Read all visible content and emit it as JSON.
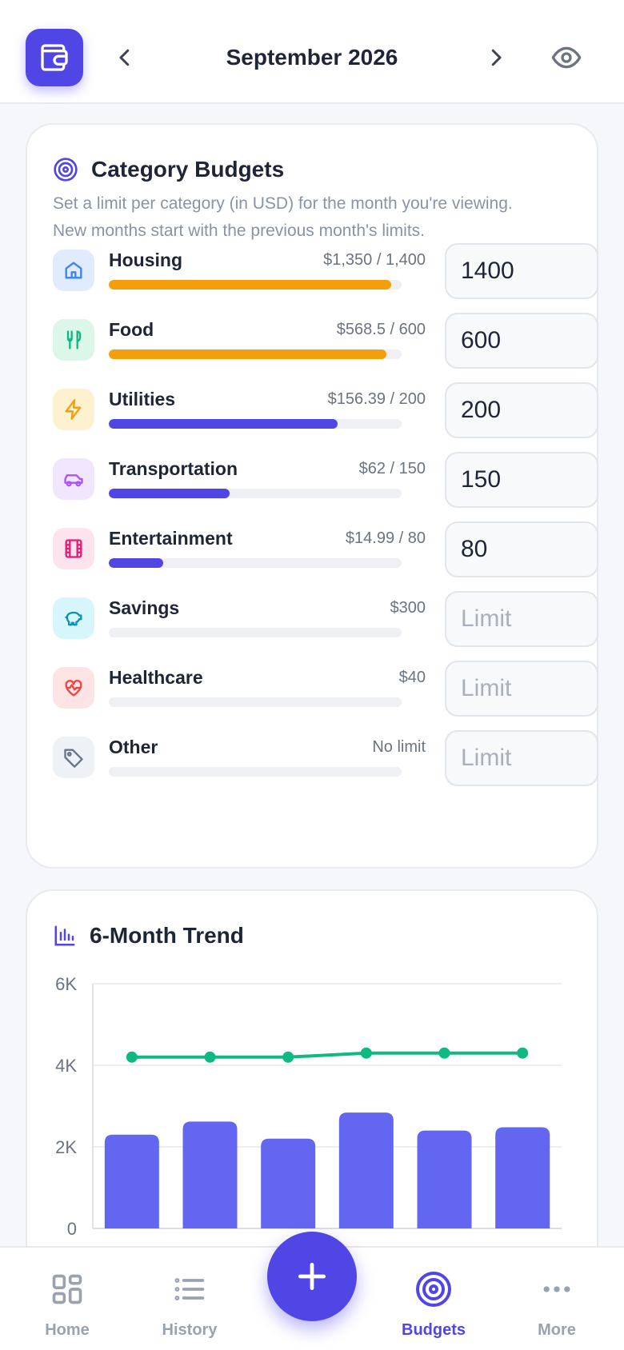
{
  "header": {
    "month_label": "September 2026"
  },
  "budgets": {
    "title": "Category Budgets",
    "description_line1": "Set a limit per category (in USD) for the month you're viewing.",
    "description_line2": "New months start with the previous month's limits.",
    "categories": [
      {
        "name": "Housing",
        "amount": "$1,350 / 1,400",
        "limit_value": "1400",
        "placeholder": "Limit",
        "progress": 0.964,
        "bar_color": "#f59e0b",
        "icon": "home-icon",
        "icon_bg": "#e0ebfd",
        "icon_color": "#3b82f6"
      },
      {
        "name": "Food",
        "amount": "$568.5 / 600",
        "limit_value": "600",
        "placeholder": "Limit",
        "progress": 0.9475,
        "bar_color": "#f59e0b",
        "icon": "fork-knife-icon",
        "icon_bg": "#dcf7ea",
        "icon_color": "#10b981"
      },
      {
        "name": "Utilities",
        "amount": "$156.39 / 200",
        "limit_value": "200",
        "placeholder": "Limit",
        "progress": 0.782,
        "bar_color": "#4f46e5",
        "icon": "bolt-icon",
        "icon_bg": "#fdf1cf",
        "icon_color": "#f59e0b"
      },
      {
        "name": "Transportation",
        "amount": "$62 / 150",
        "limit_value": "150",
        "placeholder": "Limit",
        "progress": 0.413,
        "bar_color": "#4f46e5",
        "icon": "car-icon",
        "icon_bg": "#f1e6fd",
        "icon_color": "#a855f7"
      },
      {
        "name": "Entertainment",
        "amount": "$14.99 / 80",
        "limit_value": "80",
        "placeholder": "Limit",
        "progress": 0.187,
        "bar_color": "#4f46e5",
        "icon": "film-icon",
        "icon_bg": "#fde3ee",
        "icon_color": "#e11d74"
      },
      {
        "name": "Savings",
        "amount": "$300",
        "limit_value": "",
        "placeholder": "Limit",
        "progress": 0,
        "bar_color": "#4f46e5",
        "icon": "piggy-bank-icon",
        "icon_bg": "#d6f6fb",
        "icon_color": "#0891b2"
      },
      {
        "name": "Healthcare",
        "amount": "$40",
        "limit_value": "",
        "placeholder": "Limit",
        "progress": 0,
        "bar_color": "#4f46e5",
        "icon": "heart-pulse-icon",
        "icon_bg": "#fde4e4",
        "icon_color": "#ef4444"
      },
      {
        "name": "Other",
        "amount": "No limit",
        "limit_value": "",
        "placeholder": "Limit",
        "progress": 0,
        "bar_color": "#4f46e5",
        "icon": "tag-icon",
        "icon_bg": "#eef1f5",
        "icon_color": "#64748b"
      }
    ]
  },
  "trend": {
    "title": "6-Month Trend"
  },
  "chart_data": {
    "type": "bar",
    "title": "6-Month Trend",
    "y_tick_labels": [
      "0",
      "2K",
      "4K",
      "6K"
    ],
    "ylim": [
      0,
      6000
    ],
    "grid": true,
    "series": [
      {
        "type": "bar",
        "color": "#6366f1",
        "values": [
          2300,
          2620,
          2200,
          2840,
          2400,
          2480
        ]
      },
      {
        "type": "line",
        "color": "#10b981",
        "values": [
          4200,
          4200,
          4200,
          4300,
          4300,
          4300
        ]
      }
    ]
  },
  "bottom_nav": {
    "items": [
      {
        "label": "Home",
        "icon": "grid-icon"
      },
      {
        "label": "History",
        "icon": "list-icon"
      },
      {
        "label": "Budgets",
        "icon": "target-icon",
        "active": true
      },
      {
        "label": "More",
        "icon": "more-dots-icon"
      }
    ],
    "fab_icon": "plus-icon"
  },
  "colors": {
    "accent": "#4f46e5",
    "warning": "#f59e0b",
    "income_line": "#10b981"
  }
}
